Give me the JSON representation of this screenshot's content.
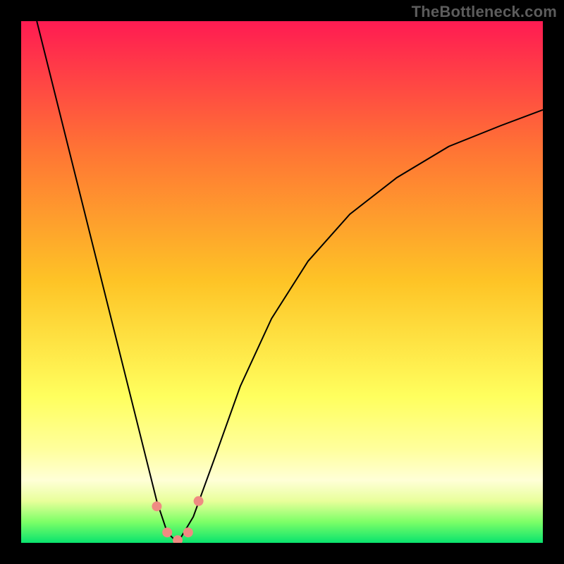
{
  "watermark": "TheBottleneck.com",
  "chart_data": {
    "type": "line",
    "title": "",
    "xlabel": "",
    "ylabel": "",
    "xlim": [
      0,
      100
    ],
    "ylim": [
      0,
      100
    ],
    "note": "Heat-gradient background (red=top, green=bottom) with a V-shaped bottleneck curve. Lower y = better. Pink markers cluster near the curve minimum.",
    "background_gradient_stops": [
      {
        "pct": 0,
        "color": "#ff1b52"
      },
      {
        "pct": 25,
        "color": "#ff7534"
      },
      {
        "pct": 50,
        "color": "#fec426"
      },
      {
        "pct": 72,
        "color": "#ffff5e"
      },
      {
        "pct": 82,
        "color": "#ffff9c"
      },
      {
        "pct": 88,
        "color": "#ffffd7"
      },
      {
        "pct": 92,
        "color": "#e8ff9a"
      },
      {
        "pct": 96,
        "color": "#7cff67"
      },
      {
        "pct": 100,
        "color": "#09e36e"
      }
    ],
    "series": [
      {
        "name": "bottleneck-curve",
        "x": [
          3,
          6,
          9,
          12,
          15,
          18,
          21,
          24,
          26,
          28,
          30,
          33,
          37,
          42,
          48,
          55,
          63,
          72,
          82,
          92,
          100
        ],
        "y": [
          100,
          88,
          76,
          64,
          52,
          40,
          28,
          16,
          8,
          2,
          0,
          5,
          16,
          30,
          43,
          54,
          63,
          70,
          76,
          80,
          83
        ]
      }
    ],
    "markers": {
      "name": "near-minimum-points",
      "points": [
        {
          "x": 26,
          "y": 7
        },
        {
          "x": 28,
          "y": 2
        },
        {
          "x": 30,
          "y": 0.5
        },
        {
          "x": 32,
          "y": 2
        },
        {
          "x": 34,
          "y": 8
        }
      ],
      "color": "#ef8b82"
    }
  }
}
